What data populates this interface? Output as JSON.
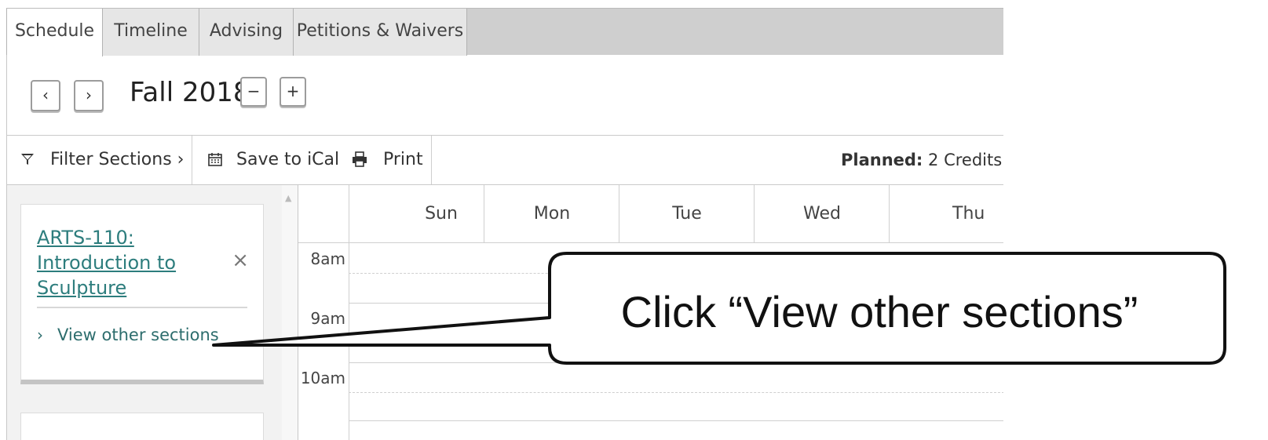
{
  "tabs": [
    {
      "label": "Schedule"
    },
    {
      "label": "Timeline"
    },
    {
      "label": "Advising"
    },
    {
      "label": "Petitions & Waivers"
    }
  ],
  "term": {
    "prev_glyph": "‹",
    "next_glyph": "›",
    "title": "Fall 2018",
    "minus_glyph": "−",
    "plus_glyph": "+"
  },
  "toolbar": {
    "filter_label": "Filter Sections ›",
    "ical_label": "Save to iCal",
    "print_label": "Print",
    "planned_label": "Planned:",
    "planned_value": "2 Credits"
  },
  "sidebar": {
    "course_link": "ARTS-110: Introduction to Sculpture",
    "remove_glyph": "×",
    "view_other_label": "View other sections",
    "view_other_chevron": "›"
  },
  "calendar": {
    "days": [
      "Sun",
      "Mon",
      "Tue",
      "Wed",
      "Thu"
    ],
    "times": [
      "8am",
      "9am",
      "10am"
    ]
  },
  "callout": {
    "text": "Click “View other sections”"
  },
  "icons": {
    "filter": "funnel-icon",
    "ical": "calendar-icon",
    "print": "printer-icon"
  },
  "colors": {
    "link": "#2d7d7d",
    "tabbar_bg": "#cfcfcf",
    "sidebar_bg": "#f2f2f2"
  }
}
